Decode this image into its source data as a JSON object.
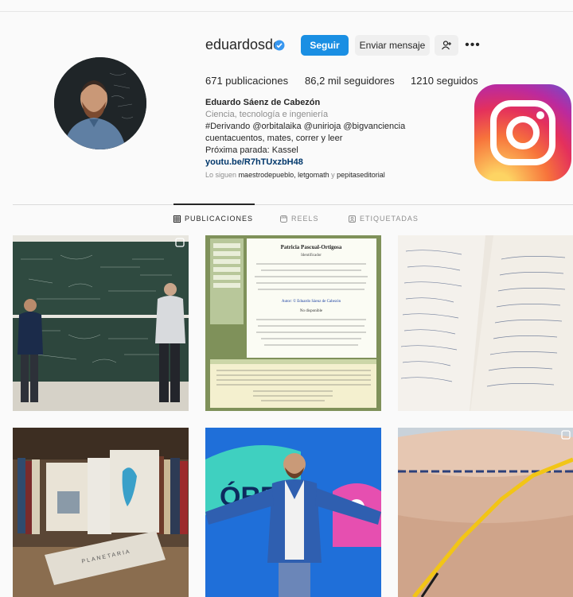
{
  "profile": {
    "username": "eduardosdc",
    "verified_icon": "verified-badge-icon",
    "buttons": {
      "follow": "Seguir",
      "message": "Enviar mensaje",
      "suggest_icon": "add-person-icon",
      "more": "•••"
    },
    "stats": {
      "posts": "671 publicaciones",
      "followers": "86,2 mil seguidores",
      "following": "1210 seguidos"
    },
    "bio": {
      "name": "Eduardo Sáenz de Cabezón",
      "category": "Ciencia, tecnología e ingeniería",
      "line1": "#Derivando @orbitalaika @unirioja @bigvanciencia",
      "line2": "cuentacuentos, mates, correr y leer",
      "line3": "Próxima parada: Kassel",
      "link": "youtu.be/R7hTUxzbH48"
    },
    "followed_by": {
      "prefix": "Lo siguen",
      "names": "maestrodepueblo, letgomath",
      "joiner": "y",
      "last": "pepitaseditorial"
    }
  },
  "tabs": [
    {
      "label": "PUBLICACIONES",
      "icon": "grid-icon",
      "active": true
    },
    {
      "label": "REELS",
      "icon": "reels-icon",
      "active": false
    },
    {
      "label": "ETIQUETADAS",
      "icon": "tagged-icon",
      "active": false
    }
  ],
  "colors": {
    "accent": "#1a8fe3",
    "link": "#00376b",
    "muted": "#8e8e8e"
  },
  "posts": {
    "p2": {
      "title": "Patricia Pascual-Ortigosa",
      "subtitle": "Identificador",
      "author_line": "Autor: © Eduardo Sáenz de Cabezón",
      "note": "No disponible"
    },
    "p5": {
      "sign": "ÓRB"
    },
    "p4": {
      "book_title": "PLANETARIA"
    }
  }
}
